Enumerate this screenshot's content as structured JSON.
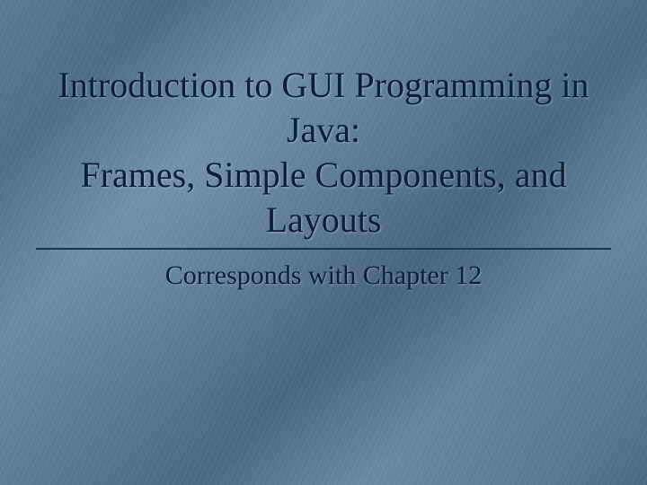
{
  "slide": {
    "title": "Introduction to GUI Programming in Java:\nFrames, Simple Components, and Layouts",
    "subtitle": "Corresponds with Chapter 12"
  }
}
